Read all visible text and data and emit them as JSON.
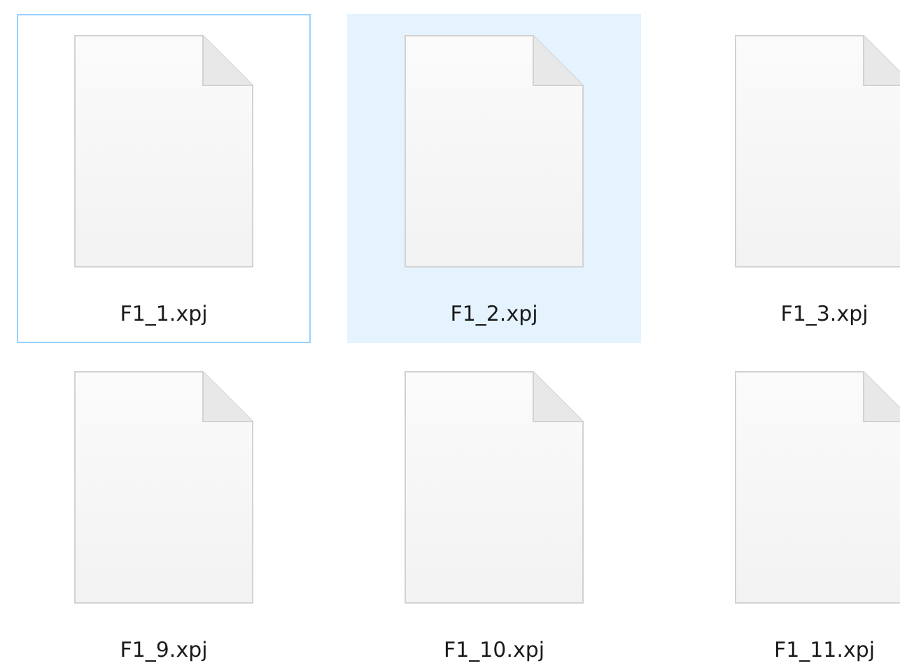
{
  "files": [
    {
      "name": "F1_1.xpj",
      "focused": true,
      "hovered": false
    },
    {
      "name": "F1_2.xpj",
      "focused": false,
      "hovered": true
    },
    {
      "name": "F1_3.xpj",
      "focused": false,
      "hovered": false
    },
    {
      "name": "F1_9.xpj",
      "focused": false,
      "hovered": false
    },
    {
      "name": "F1_10.xpj",
      "focused": false,
      "hovered": false
    },
    {
      "name": "F1_11.xpj",
      "focused": false,
      "hovered": false
    }
  ]
}
